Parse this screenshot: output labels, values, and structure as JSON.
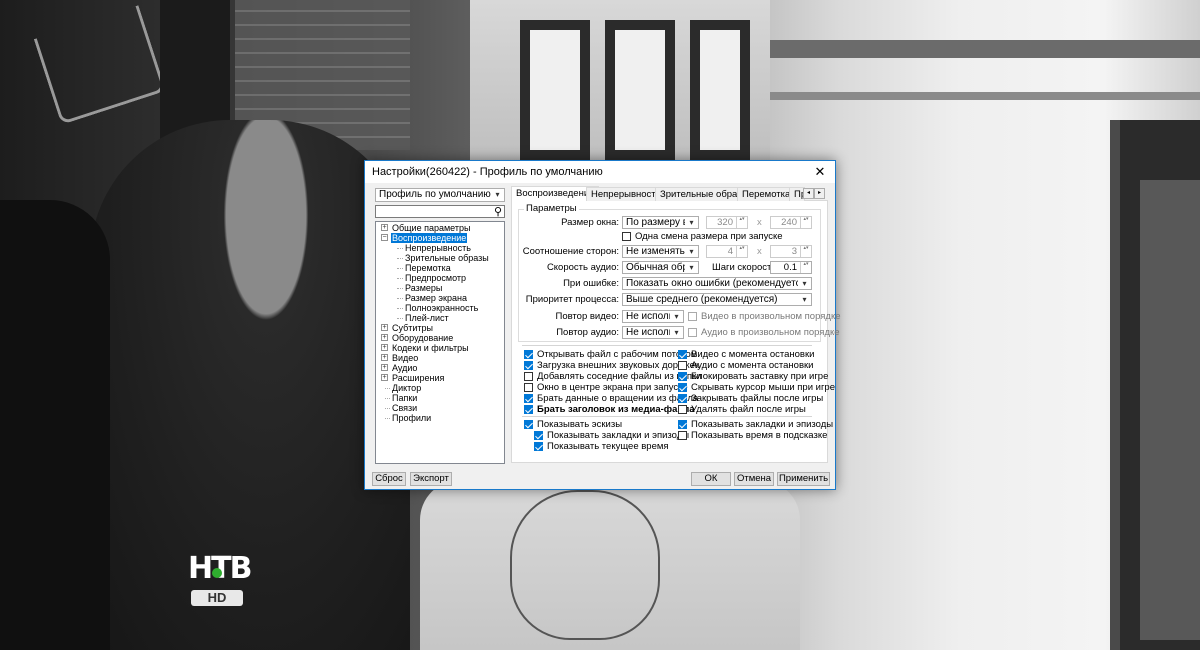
{
  "window": {
    "title": "Настройки(260422) - Профиль по умолчанию",
    "close_glyph": "✕"
  },
  "sidebar": {
    "profile_select": "Профиль по умолчанию",
    "search_placeholder": "",
    "tree": [
      {
        "label": "Общие параметры",
        "level": 0,
        "expander": "+"
      },
      {
        "label": "Воспроизведение",
        "level": 0,
        "expander": "−",
        "selected": true
      },
      {
        "label": "Непрерывность",
        "level": 1
      },
      {
        "label": "Зрительные образы",
        "level": 1
      },
      {
        "label": "Перемотка",
        "level": 1
      },
      {
        "label": "Предпросмотр",
        "level": 1
      },
      {
        "label": "Размеры",
        "level": 1
      },
      {
        "label": "Размер экрана",
        "level": 1
      },
      {
        "label": "Полноэкранность",
        "level": 1
      },
      {
        "label": "Плей-лист",
        "level": 1
      },
      {
        "label": "Субтитры",
        "level": 0,
        "expander": "+"
      },
      {
        "label": "Оборудование",
        "level": 0,
        "expander": "+"
      },
      {
        "label": "Кодеки и фильтры",
        "level": 0,
        "expander": "+"
      },
      {
        "label": "Видео",
        "level": 0,
        "expander": "+"
      },
      {
        "label": "Аудио",
        "level": 0,
        "expander": "+"
      },
      {
        "label": "Расширения",
        "level": 0,
        "expander": "+"
      },
      {
        "label": "Диктор",
        "level": 0
      },
      {
        "label": "Папки",
        "level": 0
      },
      {
        "label": "Связи",
        "level": 0
      },
      {
        "label": "Профили",
        "level": 0
      }
    ]
  },
  "tabs": [
    "Воспроизведение",
    "Непрерывность",
    "Зрительные образы",
    "Перемотка",
    "Пр"
  ],
  "tab_scroll": {
    "left": "◂",
    "right": "▸"
  },
  "params": {
    "group_label": "Параметры",
    "window_size": {
      "label": "Размер окна:",
      "value": "По размеру виде",
      "w": "320",
      "h": "240",
      "x": "x"
    },
    "once_resize": {
      "label": "Одна смена размера при запуске",
      "checked": false
    },
    "aspect": {
      "label": "Соотношение сторон:",
      "value": "Не изменять (ре",
      "w": "4",
      "h": "3",
      "x": "x"
    },
    "audio_speed": {
      "label": "Скорость аудио:",
      "value": "Обычная обрабс",
      "step_label": "Шаги скорости:",
      "step_value": "0.1"
    },
    "on_error": {
      "label": "При ошибке:",
      "value": "Показать окно ошибки (рекомендуется)"
    },
    "priority": {
      "label": "Приоритет процесса:",
      "value": "Выше среднего (рекомендуется)"
    },
    "video_repeat": {
      "label": "Повтор видео:",
      "value": "Не использо",
      "random_label": "Видео в произвольном порядке"
    },
    "audio_repeat": {
      "label": "Повтор аудио:",
      "value": "Не использо",
      "random_label": "Аудио в произвольном порядке"
    }
  },
  "checks_left": [
    {
      "label": "Открывать файл с рабочим потоком",
      "checked": true
    },
    {
      "label": "Загрузка внешних звуковых дорожек",
      "checked": true
    },
    {
      "label": "Добавлять соседние файлы из папки",
      "checked": false
    },
    {
      "label": "Окно в центре экрана при запуске",
      "checked": false
    },
    {
      "label": "Брать данные о вращении из файла",
      "checked": true
    },
    {
      "label": "Брать заголовок из медиа-файла",
      "checked": true,
      "bold": true
    }
  ],
  "checks_right": [
    {
      "label": "Видео с момента остановки",
      "checked": true
    },
    {
      "label": "Аудио с момента остановки",
      "checked": false
    },
    {
      "label": "Блокировать заставку при игре",
      "checked": true
    },
    {
      "label": "Скрывать курсор мыши при игре",
      "checked": true
    },
    {
      "label": "Закрывать файлы после игры",
      "checked": true
    },
    {
      "label": "Удалять файл после игры",
      "checked": false
    }
  ],
  "thumbs": {
    "show_thumbs": {
      "label": "Показывать эскизы",
      "checked": true
    },
    "show_bookmarks_sub": {
      "label": "Показывать закладки и эпизоды",
      "checked": true
    },
    "show_current_time": {
      "label": "Показывать текущее время",
      "checked": true
    },
    "show_bookmarks": {
      "label": "Показывать закладки и эпизоды",
      "checked": true
    },
    "show_time_hint": {
      "label": "Показывать время в подсказке",
      "checked": false
    }
  },
  "buttons": {
    "reset": "Сброс",
    "export": "Экспорт",
    "ok": "ОК",
    "cancel": "Отмена",
    "apply": "Применить"
  },
  "logo": {
    "text": "НТВ",
    "sub": "HD"
  },
  "icons": {
    "dropdown": "▾",
    "search": "⚲",
    "spin": "▴▾"
  },
  "colors": {
    "accent": "#0078d7",
    "border": "#1979ca"
  }
}
